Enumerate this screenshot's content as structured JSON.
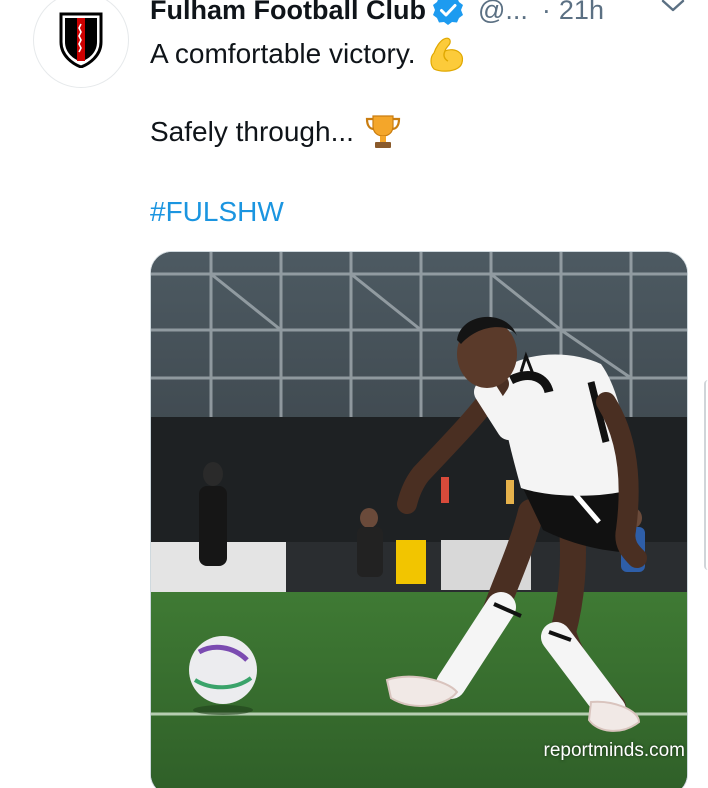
{
  "tweet": {
    "display_name": "Fulham Football Club",
    "handle": "@...",
    "separator": "·",
    "time": "21h",
    "lines": [
      "A comfortable victory.",
      "Safely through..."
    ],
    "hashtag": "#FULSHW"
  },
  "icons": {
    "avatar": "fulham-crest-icon",
    "verified": "verified-badge-icon",
    "caret": "chevron-down-icon",
    "emoji_1": "flexed-biceps-emoji",
    "emoji_2": "trophy-emoji"
  },
  "media": {
    "description": "",
    "watermark": "reportminds.com"
  },
  "colors": {
    "text": "#0f1419",
    "secondary": "#5b7083",
    "link": "#1b95e0",
    "verified": "#1d9bf0"
  }
}
